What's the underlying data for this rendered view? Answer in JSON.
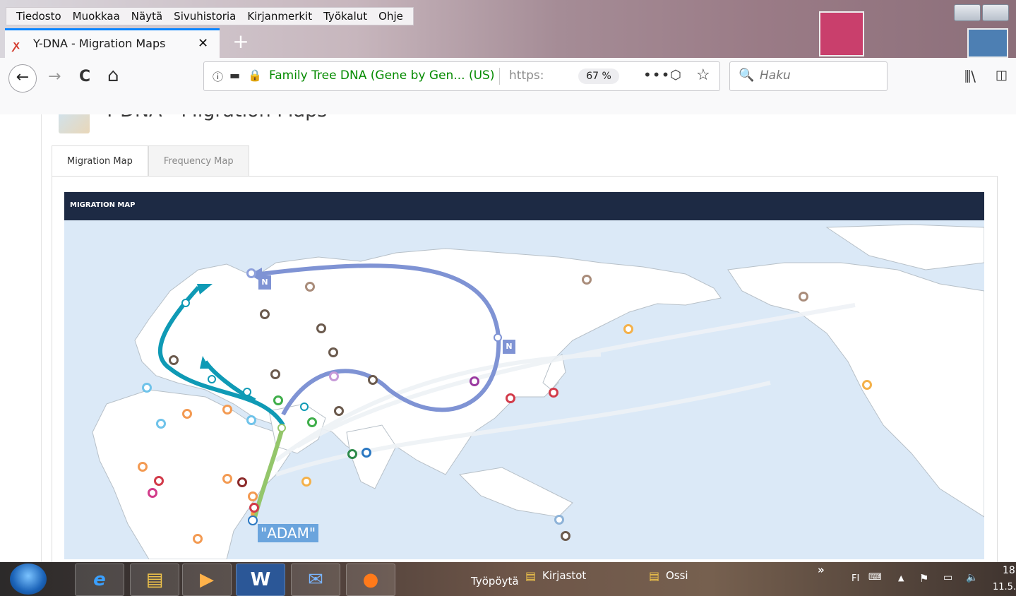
{
  "menu": {
    "items": [
      {
        "label": "Tiedosto"
      },
      {
        "label": "Muokkaa"
      },
      {
        "label": "Näytä"
      },
      {
        "label": "Sivuhistoria"
      },
      {
        "label": "Kirjanmerkit"
      },
      {
        "label": "Työkalut"
      },
      {
        "label": "Ohje"
      }
    ]
  },
  "tab": {
    "title": "Y-DNA - Migration Maps",
    "favicon_glyph": "ꭗ",
    "close_glyph": "✕",
    "new_tab_glyph": "+"
  },
  "nav": {
    "back_glyph": "←",
    "forward_glyph": "→",
    "reload_glyph": "C",
    "home_glyph": "⌂",
    "info_glyph": "ⓘ",
    "bag_glyph": "▬",
    "lock_glyph": "🔒",
    "identity": "Family Tree DNA (Gene by Gen... (US)",
    "url": "https:",
    "zoom": "67 %",
    "more_glyph": "•••",
    "pocket_glyph": "⬡",
    "star_glyph": "☆",
    "search_glyph": "🔍",
    "search_placeholder": "Haku",
    "library_glyph": "⫼\\",
    "sidebar_glyph": "◫"
  },
  "page": {
    "title": "Y-DNA - Migration Maps",
    "tabs": [
      {
        "label": "Migration Map"
      },
      {
        "label": "Frequency Map"
      }
    ],
    "map_header": "MIGRATION MAP",
    "map_labels": {
      "n1": "N",
      "n2": "N",
      "adam": "\"ADAM\""
    }
  },
  "colors": {
    "map_sea": "#dbe9f7",
    "land": "#ffffff",
    "border": "#b7c0c8",
    "route_blue": "#7f93d4",
    "route_teal": "#0f9ab5",
    "route_green": "#94c66b",
    "header": "#1d2a44"
  },
  "taskbar": {
    "buttons": [
      {
        "name": "ie",
        "glyph": "e"
      },
      {
        "name": "explorer",
        "glyph": "▤"
      },
      {
        "name": "media",
        "glyph": "▶"
      },
      {
        "name": "word",
        "glyph": "W"
      },
      {
        "name": "thunderbird",
        "glyph": "✉"
      },
      {
        "name": "firefox",
        "glyph": "●"
      }
    ],
    "toolbars": [
      "Työpöytä",
      "Kirjastot",
      "Ossi"
    ],
    "chevron": "»",
    "lang": "FI",
    "clock_time": "18",
    "clock_date": "11.5."
  }
}
